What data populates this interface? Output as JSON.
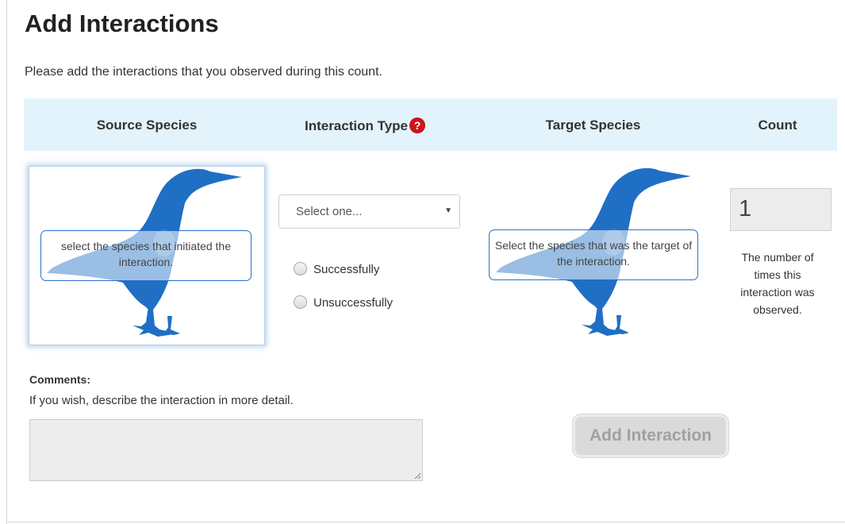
{
  "page": {
    "title": "Add Interactions",
    "intro": "Please add the interactions that you observed during this count."
  },
  "table_header": {
    "source_species": "Source Species",
    "interaction_type": "Interaction Type",
    "help_icon_glyph": "?",
    "target_species": "Target Species",
    "count": "Count"
  },
  "source": {
    "label": "select the species that initiated the interaction.",
    "icon": "bird-silhouette-icon"
  },
  "interaction": {
    "select_value": "Select one...",
    "radio_options": [
      "Successfully",
      "Unsuccessfully"
    ]
  },
  "target": {
    "label": "Select the species that was the target of the interaction.",
    "icon": "bird-silhouette-icon"
  },
  "count": {
    "value": "1",
    "help": "The number of times this interaction was observed."
  },
  "comments": {
    "label": "Comments:",
    "help": "If you wish, describe the interaction in more detail.",
    "value": ""
  },
  "actions": {
    "add_button": "Add Interaction"
  },
  "colors": {
    "header_bg": "#e3f3fb",
    "bird_blue": "#1f6fc4",
    "help_red": "#c8161d",
    "disabled_button": "#dadada"
  }
}
